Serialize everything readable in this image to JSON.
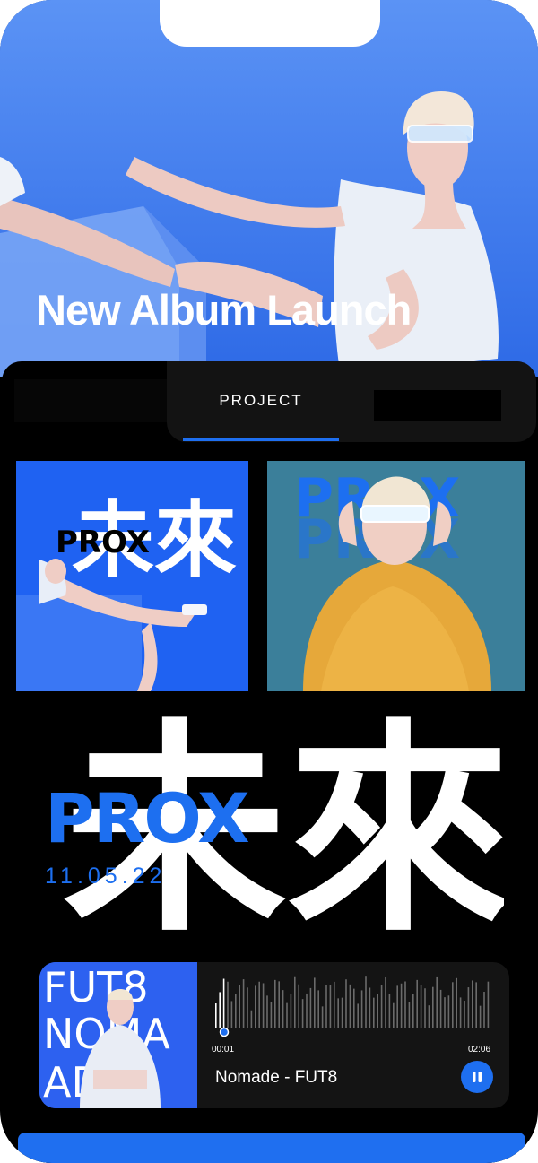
{
  "hero": {
    "title": "New Album Launch"
  },
  "tabs": {
    "active_label": "PROJECT"
  },
  "covers": [
    {
      "name": "prox-mirai-cover",
      "prox": "PROX",
      "kanji": "未來"
    },
    {
      "name": "prox-yellow-jacket-cover",
      "prox": "PROX"
    }
  ],
  "feature": {
    "kanji": "未來",
    "prox": "PROX",
    "date": "11.05.22"
  },
  "player": {
    "art_text": [
      "FUT8",
      "NOMA",
      "ADE"
    ],
    "time_current": "00:01",
    "time_total": "02:06",
    "track": "Nomade - FUT8",
    "progress": 0.02
  },
  "colors": {
    "accent": "#1E6FF0",
    "hero_bg": "#3D7BF6",
    "panel_bg": "#000000",
    "player_bg": "#141414"
  }
}
